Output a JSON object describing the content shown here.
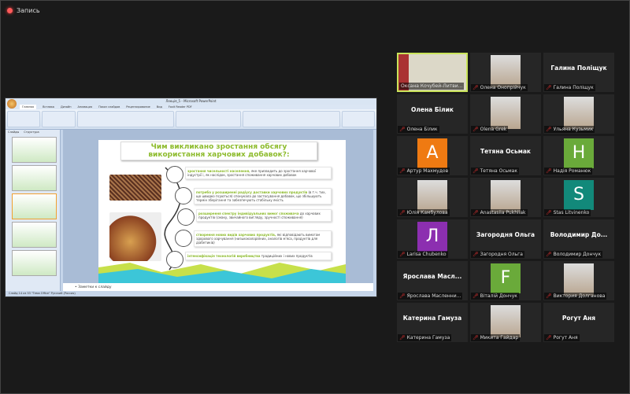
{
  "recording": {
    "label": "Запись",
    "color": "#ff5a5a"
  },
  "powerpoint": {
    "window_title": "Лекція_5 - Microsoft PowerPoint",
    "tabs": [
      "Главная",
      "Вставка",
      "Дизайн",
      "Анимация",
      "Показ слайдов",
      "Рецензирование",
      "Вид",
      "Foxit Reader PDF"
    ],
    "side_tabs": [
      "Слайды",
      "Структура"
    ],
    "notes_placeholder": "Заметки к слайду",
    "status": "Слайд 14 из 53   \"Тема Office\"   Русский (Россия)",
    "slide": {
      "title": "Чим викликано зростання обсягу використання харчових добавок?:",
      "items": [
        {
          "bold": "зростання чисельності населення,",
          "text": " яке призводить до зростання харчової індустрії і, як наслідок, зростання споживання харчових добавок"
        },
        {
          "bold": "потреба у розширенні радіусу доставки харчових продуктів",
          "text": " (в т.ч. тих, що швидко псуються) спонукала до застосування добавок, що збільшують термін зберігання та забезпечують стабільну якість"
        },
        {
          "bold": "розширення спектру індивідуальних вимог споживача",
          "text": " до харчових продуктів (смаку, звичайного вигляду, зручності споживання)"
        },
        {
          "bold": "створення нових видів харчових продуктів,",
          "text": " які відповідають вимогам здорового харчування (низькокалорійних, аналогів м'яса, продуктів для діабетиків)"
        },
        {
          "bold": "інтенсифікація технологій виробництва",
          "text": " традиційних і нових продуктів"
        }
      ]
    }
  },
  "participants": [
    {
      "label": "Оксана Кочубей-Литви...",
      "video": true,
      "active": true
    },
    {
      "label": "Олена Онопрійчук",
      "video": true
    },
    {
      "label": "Галина Поліщук",
      "display_name": "Галина Поліщук"
    },
    {
      "label": "Олена Білик",
      "display_name": "Олена Білик"
    },
    {
      "label": "Olena Grek",
      "video": true
    },
    {
      "label": "Ульяна Кузьмик",
      "video": true
    },
    {
      "label": "Артур Махмудов",
      "avatar_letter": "A",
      "avatar_color": "#ef7a12"
    },
    {
      "label": "Тетяна Осьмак",
      "display_name": "Тетяна Осьмак"
    },
    {
      "label": "Надія Романюк",
      "avatar_letter": "H",
      "avatar_color": "#6aaa3a"
    },
    {
      "label": "Юлія  Камбулова",
      "video": true
    },
    {
      "label": "Anastasiia Pukhliak",
      "video": true
    },
    {
      "label": "Stas Litvinenko",
      "avatar_letter": "S",
      "avatar_color": "#12897a"
    },
    {
      "label": "Larisa Chubenko",
      "avatar_letter": "Л",
      "avatar_color": "#8c2fb0"
    },
    {
      "label": "Загородня Ольга",
      "display_name": "Загородня Ольга"
    },
    {
      "label": "Володимир Дончук",
      "display_name": "Володимир  До..."
    },
    {
      "label": "Ярослава Масленни...",
      "display_name": "Ярослава  Масл..."
    },
    {
      "label": "Віталій Дончук",
      "avatar_letter": "F",
      "avatar_color": "#6aaa3a"
    },
    {
      "label": "Виктория Долганова",
      "video": true
    },
    {
      "label": "Катерина Гамуза",
      "display_name": "Катерина Гамуза"
    },
    {
      "label": "Микита Гайдар",
      "video": true
    },
    {
      "label": "Рогут Аня",
      "display_name": "Рогут Аня"
    }
  ]
}
